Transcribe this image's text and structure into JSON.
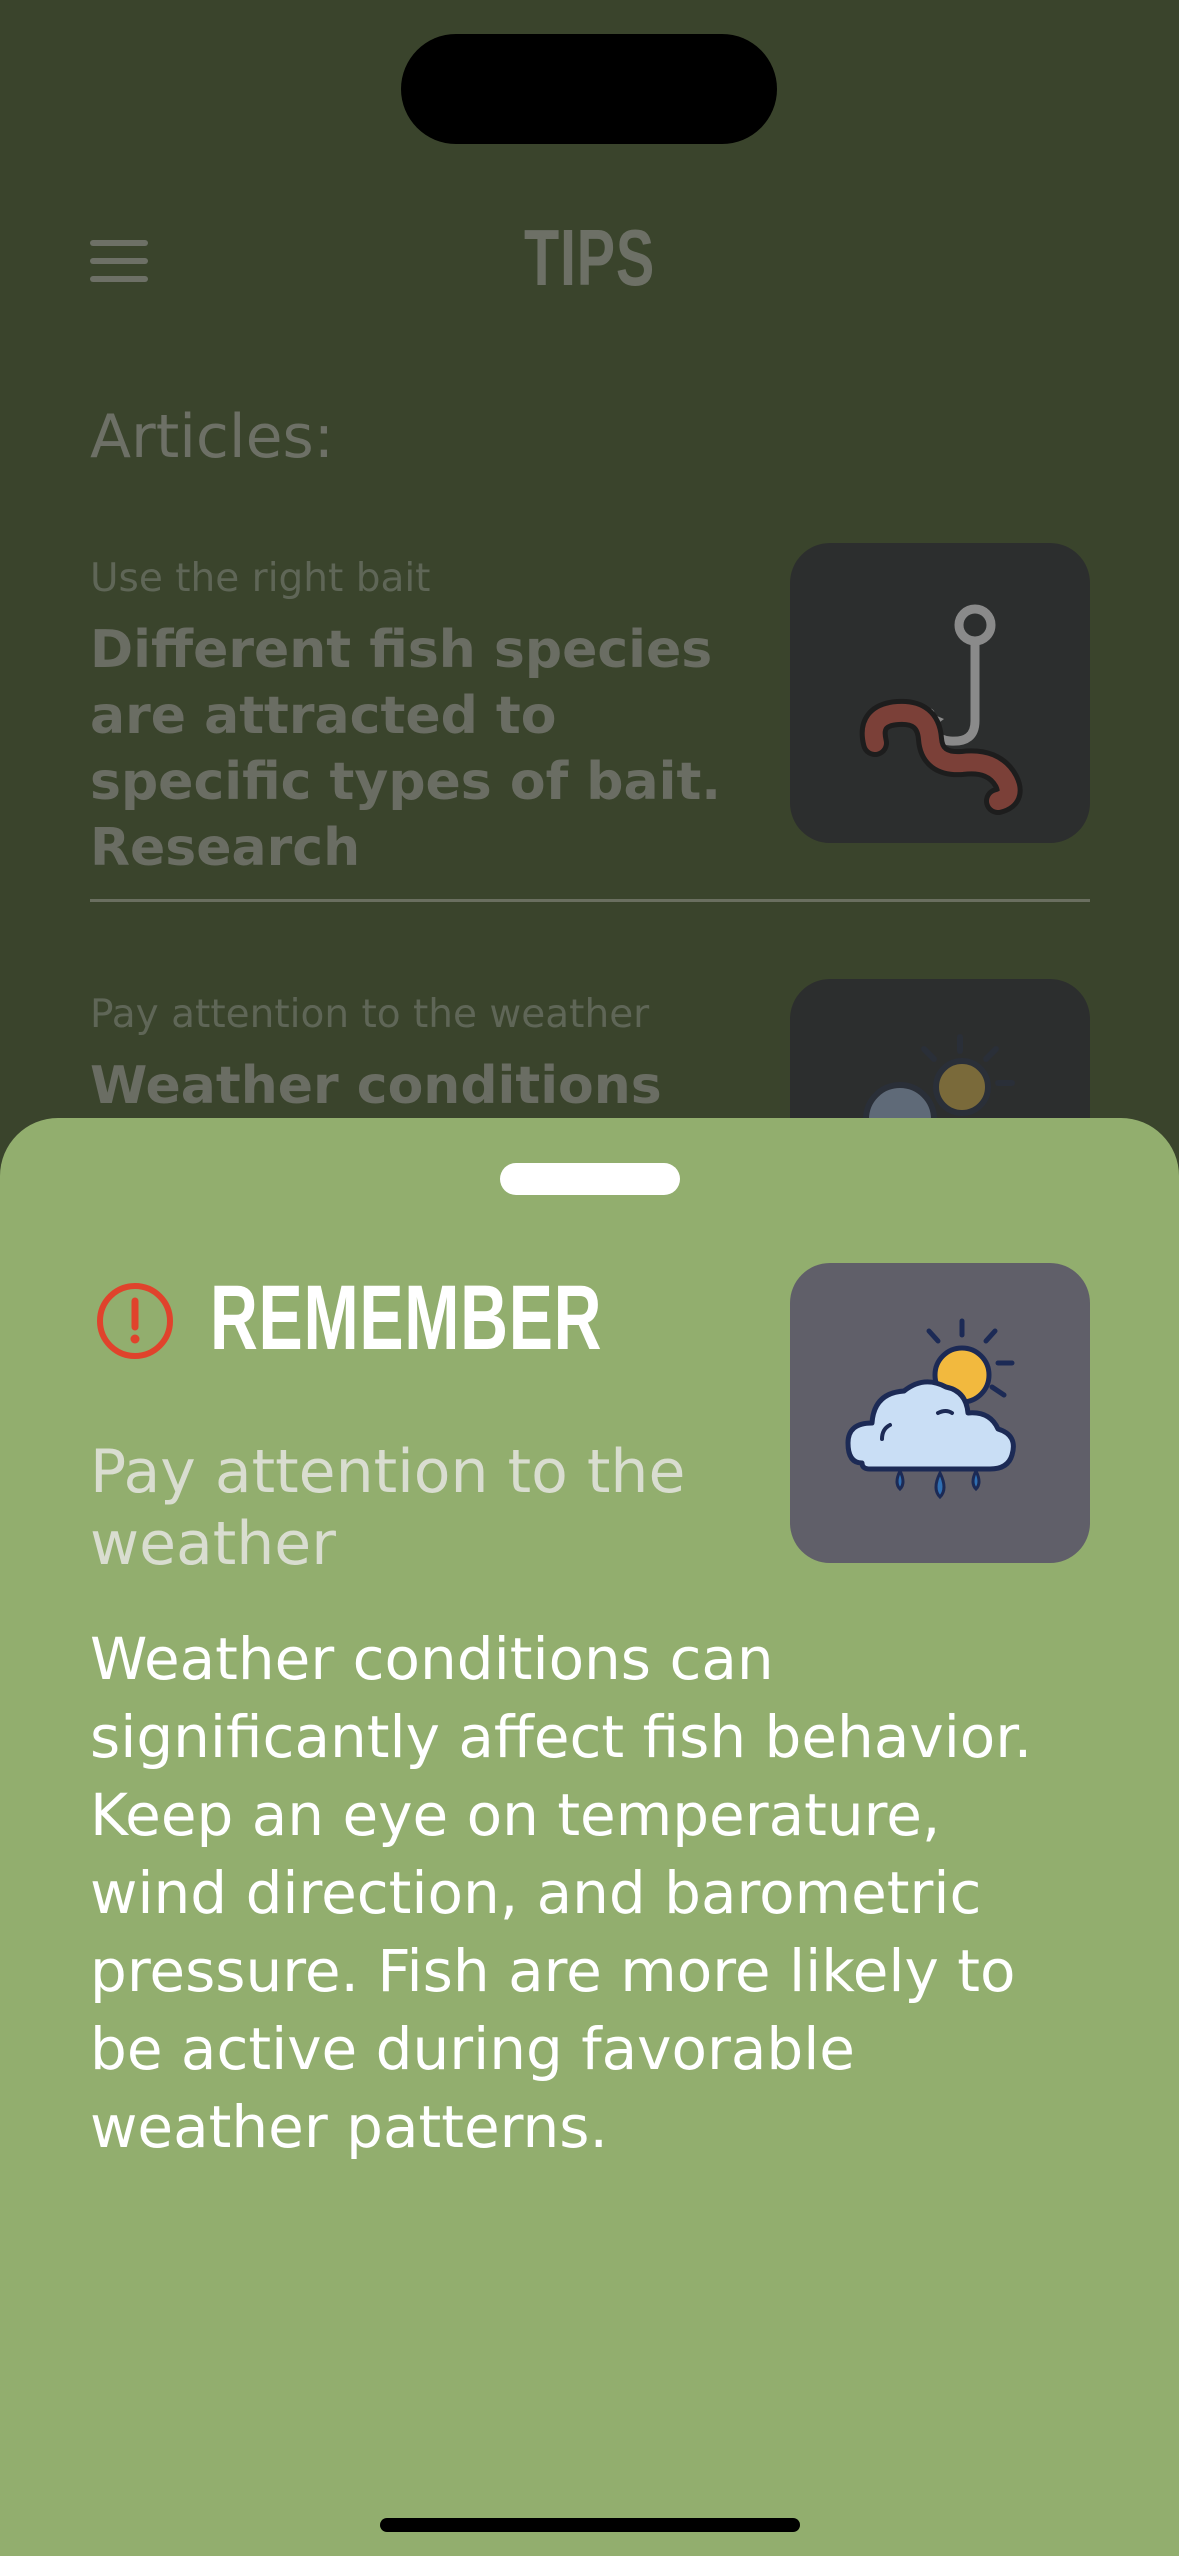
{
  "header": {
    "title": "TIPS",
    "menu_icon": "hamburger-menu-icon"
  },
  "articles_section": {
    "title": "Articles:"
  },
  "articles": [
    {
      "subtitle": "Use the right bait",
      "body": "Different fish species are attracted to specific types of bait. Research",
      "icon": "worm-hook-icon"
    },
    {
      "subtitle": "Pay attention to the weather",
      "body": "Weather conditions",
      "icon": "weather-icon"
    }
  ],
  "sheet": {
    "heading": "REMEMBER",
    "alert_icon": "exclamation-circle-icon",
    "subtitle": "Pay attention to the weather",
    "body": "Weather conditions can significantly affect fish behavior. Keep an eye on temperature, wind direction, and barometric pressure. Fish are more likely to be active during favorable weather patterns.",
    "icon": "weather-icon"
  },
  "colors": {
    "background": "#3a442c",
    "sheet": "#92ae6e",
    "alert": "#e0432c",
    "thumb_dark": "#2c2e2e",
    "thumb_sheet": "#605f69"
  }
}
